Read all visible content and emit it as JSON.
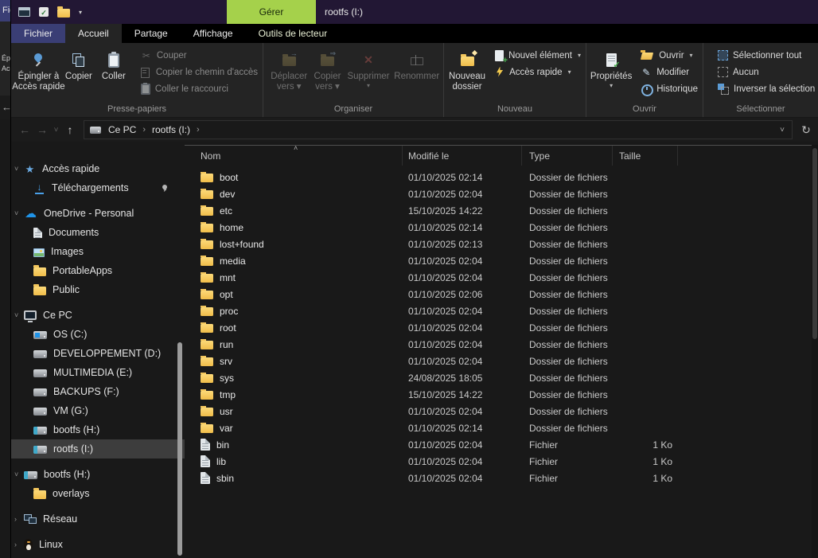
{
  "window": {
    "title": "rootfs (I:)",
    "manage_tab": "Gérer"
  },
  "bg_window_edge": {
    "fragments": [
      "Fic",
      "Épi",
      "Acc"
    ],
    "back_arrow": "←"
  },
  "qat": {
    "caret": "▾"
  },
  "tabs": [
    {
      "label": "Fichier",
      "style": "file"
    },
    {
      "label": "Accueil",
      "active": true
    },
    {
      "label": "Partage"
    },
    {
      "label": "Affichage"
    },
    {
      "label": "Outils de lecteur",
      "style": "contextual"
    }
  ],
  "ribbon": {
    "groups": [
      {
        "label": "Presse-papiers",
        "large": [
          {
            "label": "Épingler à Accès rapide",
            "lines": [
              "Épingler à",
              "Accès rapide"
            ],
            "icon": "pin-large"
          },
          {
            "label": "Copier",
            "lines": [
              "Copier"
            ],
            "icon": "copy"
          },
          {
            "label": "Coller",
            "lines": [
              "Coller"
            ],
            "icon": "paste"
          }
        ],
        "small": [
          {
            "label": "Couper",
            "icon": "cut",
            "disabled": true
          },
          {
            "label": "Copier le chemin d'accès",
            "icon": "copy-path",
            "disabled": true
          },
          {
            "label": "Coller le raccourci",
            "icon": "paste-shortcut",
            "disabled": true
          }
        ]
      },
      {
        "label": "Organiser",
        "large": [
          {
            "label": "Déplacer vers",
            "lines": [
              "Déplacer",
              "vers ▾"
            ],
            "icon": "move-to",
            "disabled": true
          },
          {
            "label": "Copier vers",
            "lines": [
              "Copier",
              "vers ▾"
            ],
            "icon": "copy-to",
            "disabled": true
          },
          {
            "label": "Supprimer",
            "lines": [
              "Supprimer",
              "▾"
            ],
            "icon": "delete",
            "disabled": true
          },
          {
            "label": "Renommer",
            "lines": [
              "Renommer"
            ],
            "icon": "rename",
            "disabled": true
          }
        ]
      },
      {
        "label": "Nouveau",
        "large": [
          {
            "label": "Nouveau dossier",
            "lines": [
              "Nouveau",
              "dossier"
            ],
            "icon": "new-folder"
          }
        ],
        "small": [
          {
            "label": "Nouvel élément",
            "icon": "new-item",
            "caret": true
          },
          {
            "label": "Accès rapide",
            "icon": "easy-access",
            "caret": true
          }
        ]
      },
      {
        "label": "Ouvrir",
        "large": [
          {
            "label": "Propriétés",
            "lines": [
              "Propriétés",
              "▾"
            ],
            "icon": "properties"
          }
        ],
        "small": [
          {
            "label": "Ouvrir",
            "icon": "open",
            "caret": true
          },
          {
            "label": "Modifier",
            "icon": "edit"
          },
          {
            "label": "Historique",
            "icon": "history"
          }
        ]
      },
      {
        "label": "Sélectionner",
        "small": [
          {
            "label": "Sélectionner tout",
            "icon": "select-all"
          },
          {
            "label": "Aucun",
            "icon": "select-none"
          },
          {
            "label": "Inverser la sélection",
            "icon": "invert-selection"
          }
        ]
      }
    ]
  },
  "address_bar": {
    "icons": {
      "back": "←",
      "forward": "→",
      "history_caret": "˅",
      "up": "↑",
      "dropdown_caret": "˅",
      "refresh": "↻",
      "separator": "›"
    },
    "breadcrumbs": [
      "Ce PC",
      "rootfs (I:)"
    ]
  },
  "sidebar": {
    "items": [
      {
        "label": "Accès rapide",
        "icon": "star",
        "level": 0,
        "expander": "expanded"
      },
      {
        "label": "Téléchargements",
        "icon": "downloads",
        "level": 1,
        "pinned": true
      },
      {
        "label": "OneDrive - Personal",
        "icon": "cloud",
        "level": 0,
        "section": true,
        "expander": "expanded"
      },
      {
        "label": "Documents",
        "icon": "documents",
        "level": 1
      },
      {
        "label": "Images",
        "icon": "pictures",
        "level": 1
      },
      {
        "label": "PortableApps",
        "icon": "folder",
        "level": 1
      },
      {
        "label": "Public",
        "icon": "folder",
        "level": 1
      },
      {
        "label": "Ce PC",
        "icon": "computer",
        "level": 0,
        "section": true,
        "expander": "expanded"
      },
      {
        "label": "OS (C:)",
        "icon": "os-drive",
        "level": 1
      },
      {
        "label": "DEVELOPPEMENT (D:)",
        "icon": "drive",
        "level": 1
      },
      {
        "label": "MULTIMEDIA (E:)",
        "icon": "drive",
        "level": 1
      },
      {
        "label": "BACKUPS (F:)",
        "icon": "drive",
        "level": 1
      },
      {
        "label": "VM (G:)",
        "icon": "drive",
        "level": 1
      },
      {
        "label": "bootfs (H:)",
        "icon": "removable-drive",
        "level": 1
      },
      {
        "label": "rootfs (I:)",
        "icon": "removable-drive",
        "level": 1,
        "selected": true
      },
      {
        "label": "bootfs (H:)",
        "icon": "removable-drive",
        "level": 0,
        "section": true,
        "expander": "expanded"
      },
      {
        "label": "overlays",
        "icon": "folder",
        "level": 1
      },
      {
        "label": "Réseau",
        "icon": "network",
        "level": 0,
        "section": true,
        "expander": "collapsed"
      },
      {
        "label": "Linux",
        "icon": "linux",
        "level": 0,
        "section": true,
        "expander": "collapsed"
      }
    ]
  },
  "file_list": {
    "sort_caret": "˄",
    "columns": [
      "Nom",
      "Modifié le",
      "Type",
      "Taille"
    ],
    "rows": [
      {
        "name": "boot",
        "modified": "01/10/2025 02:14",
        "type": "Dossier de fichiers",
        "size": "",
        "icon": "folder"
      },
      {
        "name": "dev",
        "modified": "01/10/2025 02:04",
        "type": "Dossier de fichiers",
        "size": "",
        "icon": "folder"
      },
      {
        "name": "etc",
        "modified": "15/10/2025 14:22",
        "type": "Dossier de fichiers",
        "size": "",
        "icon": "folder"
      },
      {
        "name": "home",
        "modified": "01/10/2025 02:14",
        "type": "Dossier de fichiers",
        "size": "",
        "icon": "folder"
      },
      {
        "name": "lost+found",
        "modified": "01/10/2025 02:13",
        "type": "Dossier de fichiers",
        "size": "",
        "icon": "folder"
      },
      {
        "name": "media",
        "modified": "01/10/2025 02:04",
        "type": "Dossier de fichiers",
        "size": "",
        "icon": "folder"
      },
      {
        "name": "mnt",
        "modified": "01/10/2025 02:04",
        "type": "Dossier de fichiers",
        "size": "",
        "icon": "folder"
      },
      {
        "name": "opt",
        "modified": "01/10/2025 02:06",
        "type": "Dossier de fichiers",
        "size": "",
        "icon": "folder"
      },
      {
        "name": "proc",
        "modified": "01/10/2025 02:04",
        "type": "Dossier de fichiers",
        "size": "",
        "icon": "folder"
      },
      {
        "name": "root",
        "modified": "01/10/2025 02:04",
        "type": "Dossier de fichiers",
        "size": "",
        "icon": "folder"
      },
      {
        "name": "run",
        "modified": "01/10/2025 02:04",
        "type": "Dossier de fichiers",
        "size": "",
        "icon": "folder"
      },
      {
        "name": "srv",
        "modified": "01/10/2025 02:04",
        "type": "Dossier de fichiers",
        "size": "",
        "icon": "folder"
      },
      {
        "name": "sys",
        "modified": "24/08/2025 18:05",
        "type": "Dossier de fichiers",
        "size": "",
        "icon": "folder"
      },
      {
        "name": "tmp",
        "modified": "15/10/2025 14:22",
        "type": "Dossier de fichiers",
        "size": "",
        "icon": "folder"
      },
      {
        "name": "usr",
        "modified": "01/10/2025 02:04",
        "type": "Dossier de fichiers",
        "size": "",
        "icon": "folder"
      },
      {
        "name": "var",
        "modified": "01/10/2025 02:14",
        "type": "Dossier de fichiers",
        "size": "",
        "icon": "folder"
      },
      {
        "name": "bin",
        "modified": "01/10/2025 02:04",
        "type": "Fichier",
        "size": "1 Ko",
        "icon": "file"
      },
      {
        "name": "lib",
        "modified": "01/10/2025 02:04",
        "type": "Fichier",
        "size": "1 Ko",
        "icon": "file"
      },
      {
        "name": "sbin",
        "modified": "01/10/2025 02:04",
        "type": "Fichier",
        "size": "1 Ko",
        "icon": "file"
      }
    ]
  }
}
